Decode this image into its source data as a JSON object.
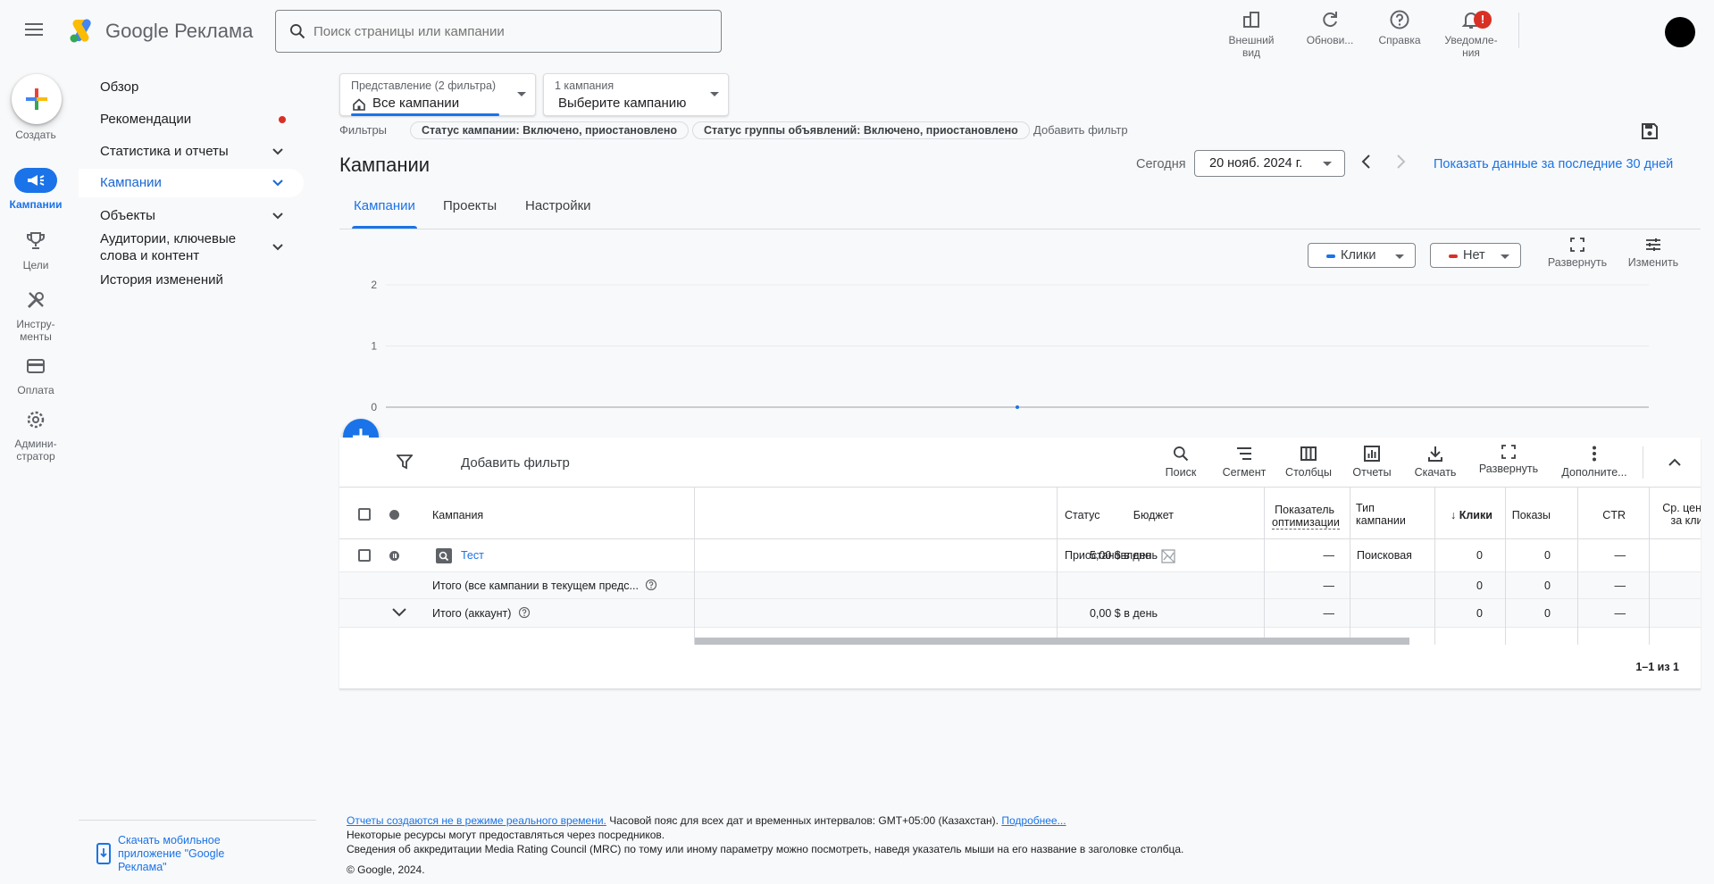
{
  "header": {
    "brand_google": "Google",
    "brand_product": "Реклама",
    "search_placeholder": "Поиск страницы или кампании",
    "actions": [
      {
        "label_line1": "Внешний",
        "label_line2": "вид",
        "icon": "appearance-icon"
      },
      {
        "label_line1": "Обнови...",
        "label_line2": "",
        "icon": "refresh-icon"
      },
      {
        "label_line1": "Справка",
        "label_line2": "",
        "icon": "help-icon"
      },
      {
        "label_line1": "Уведомле-",
        "label_line2": "ния",
        "icon": "bell-icon"
      }
    ],
    "notification_badge": "!"
  },
  "rail": {
    "create": "Создать",
    "items": [
      {
        "label_line1": "Кампании",
        "label_line2": "",
        "icon": "megaphone-icon",
        "active": true
      },
      {
        "label_line1": "Цели",
        "label_line2": "",
        "icon": "trophy-icon"
      },
      {
        "label_line1": "Инстру-",
        "label_line2": "менты",
        "icon": "tools-icon"
      },
      {
        "label_line1": "Оплата",
        "label_line2": "",
        "icon": "card-icon"
      },
      {
        "label_line1": "Админи-",
        "label_line2": "стратор",
        "icon": "gear-icon"
      }
    ]
  },
  "nav": {
    "items": [
      {
        "label": "Обзор"
      },
      {
        "label": "Рекомендации",
        "dot": true
      },
      {
        "label": "Статистика и отчеты",
        "chevron": true
      },
      {
        "label": "Кампании",
        "chevron": true,
        "active": true
      },
      {
        "label": "Объекты",
        "chevron": true
      },
      {
        "label": "Аудитории, ключевые слова и контент",
        "chevron": true
      },
      {
        "label": "История изменений"
      }
    ],
    "mobile_app": "Скачать мобильное приложение \"Google Реклама\""
  },
  "view": {
    "view_small": "Представление (2 фильтра)",
    "view_big": "Все кампании",
    "campaign_small": "1 кампания",
    "campaign_big": "Выберите кампанию"
  },
  "filters": {
    "label": "Фильтры",
    "chips": [
      "Статус кампании: Включено, приостановлено",
      "Статус группы объявлений: Включено, приостановлено"
    ],
    "add": "Добавить фильтр"
  },
  "page": {
    "title": "Кампании",
    "today": "Сегодня",
    "date": "20 нояб. 2024 г.",
    "last30": "Показать данные за последние 30 дней",
    "tabs": [
      "Кампании",
      "Проекты",
      "Настройки"
    ]
  },
  "chart_controls": {
    "metric1": "Клики",
    "metric2": "Нет",
    "expand": "Развернуть",
    "edit": "Изменить",
    "metric1_color": "#1a73e8",
    "metric2_color": "#d93025"
  },
  "chart_data": {
    "type": "line",
    "y_ticks": [
      0,
      1,
      2
    ],
    "ylim": [
      0,
      2
    ],
    "series": [
      {
        "values": [
          0
        ],
        "color": "#1a73e8"
      }
    ]
  },
  "table": {
    "toolbar": {
      "add_filter": "Добавить фильтр",
      "actions": [
        "Поиск",
        "Сегмент",
        "Столбцы",
        "Отчеты",
        "Скачать",
        "Развернуть",
        "Дополните..."
      ]
    },
    "headers": {
      "campaign": "Кампания",
      "budget": "Бюджет",
      "status": "Статус",
      "opt_line1": "Показатель",
      "opt_line2": "оптимизации",
      "type_line1": "Тип",
      "type_line2": "кампании",
      "clicks": "Клики",
      "impressions": "Показы",
      "ctr": "CTR",
      "avgcpc_line1": "Ср. цена",
      "avgcpc_line2": "за клик"
    },
    "rows": [
      {
        "campaign": "Тест",
        "budget": "5,00 $ в день",
        "status": "Приостановлено",
        "opt": "—",
        "type": "Поисковая",
        "clicks": "0",
        "impr": "0",
        "ctr": "—"
      }
    ],
    "total_view": {
      "label": "Итого (все кампании в текущем предс...",
      "opt": "—",
      "clicks": "0",
      "impr": "0",
      "ctr": "—"
    },
    "total_account": {
      "label": "Итого (аккаунт)",
      "budget": "0,00 $ в день",
      "opt": "—",
      "clicks": "0",
      "impr": "0",
      "ctr": "—"
    },
    "pager": "1–1 из 1"
  },
  "footer": {
    "link1": "Отчеты создаются не в режиме реального времени.",
    "text1": " Часовой пояс для всех дат и временных интервалов: GMT+05:00 (Казахстан). ",
    "link2": "Подробнее...",
    "line2": "Некоторые ресурсы могут предоставляться через посредников.",
    "line3": "Сведения об аккредитации Media Rating Council (MRC) по тому или иному параметру можно посмотреть, наведя указатель мыши на его название в заголовке столбца.",
    "copyright": "© Google, 2024."
  }
}
